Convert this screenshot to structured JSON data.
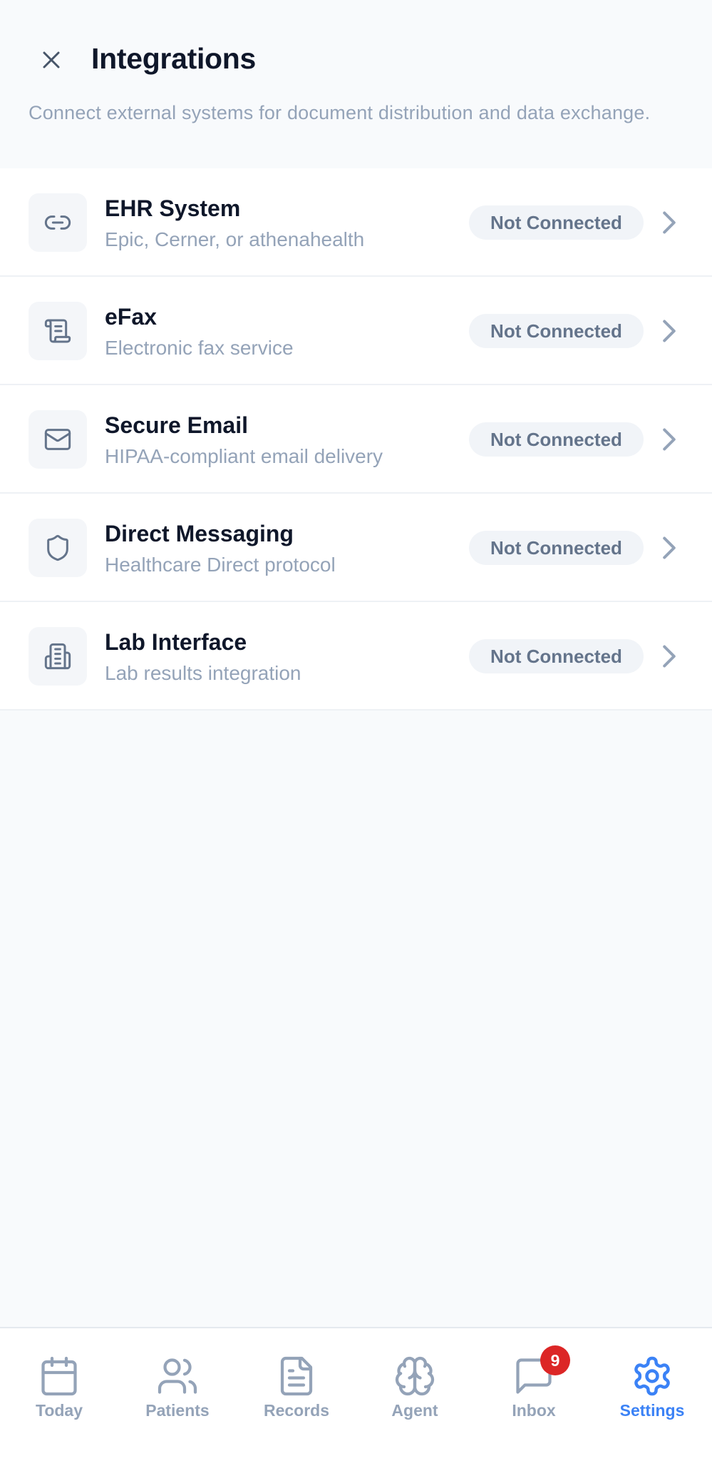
{
  "header": {
    "title": "Integrations",
    "subtitle": "Connect external systems for document distribution and data exchange.",
    "close_icon": "close-icon"
  },
  "integrations": [
    {
      "name": "EHR System",
      "description": "Epic, Cerner, or athenahealth",
      "status": "Not Connected",
      "icon": "link-icon"
    },
    {
      "name": "eFax",
      "description": "Electronic fax service",
      "status": "Not Connected",
      "icon": "scroll-icon"
    },
    {
      "name": "Secure Email",
      "description": "HIPAA-compliant email delivery",
      "status": "Not Connected",
      "icon": "mail-icon"
    },
    {
      "name": "Direct Messaging",
      "description": "Healthcare Direct protocol",
      "status": "Not Connected",
      "icon": "shield-icon"
    },
    {
      "name": "Lab Interface",
      "description": "Lab results integration",
      "status": "Not Connected",
      "icon": "building-icon"
    }
  ],
  "tabbar": {
    "tabs": [
      {
        "label": "Today",
        "icon": "calendar-icon",
        "active": false
      },
      {
        "label": "Patients",
        "icon": "users-icon",
        "active": false
      },
      {
        "label": "Records",
        "icon": "file-text-icon",
        "active": false
      },
      {
        "label": "Agent",
        "icon": "brain-icon",
        "active": false
      },
      {
        "label": "Inbox",
        "icon": "message-icon",
        "active": false,
        "badge": "9"
      },
      {
        "label": "Settings",
        "icon": "gear-icon",
        "active": true
      }
    ]
  },
  "colors": {
    "background": "#f8fafc",
    "title": "#0f172a",
    "muted": "#94a3b8",
    "badge_bg": "#f1f4f8",
    "badge_text": "#64748b",
    "accent": "#3b82f6",
    "notification": "#dc2626"
  }
}
